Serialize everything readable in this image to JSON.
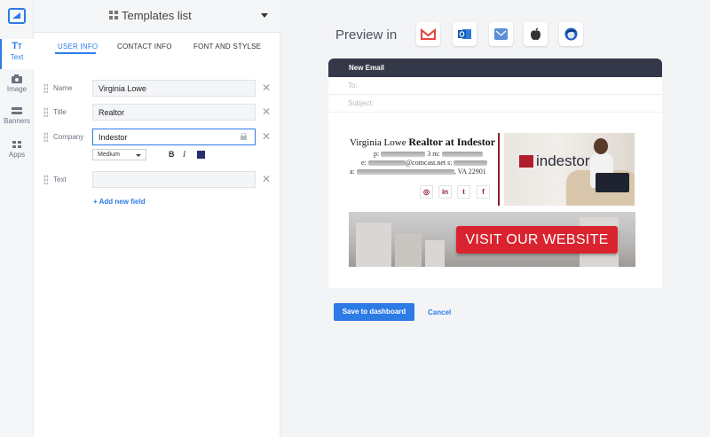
{
  "rail": {
    "items": [
      {
        "label": "Text",
        "icon": "text-icon",
        "active": true
      },
      {
        "label": "Image",
        "icon": "camera-icon"
      },
      {
        "label": "Banners",
        "icon": "banners-icon"
      },
      {
        "label": "Apps",
        "icon": "apps-icon"
      }
    ]
  },
  "panel": {
    "title": "Templates list",
    "tabs": [
      "USER INFO",
      "CONTACT INFO",
      "FONT AND STYLSE"
    ],
    "fields": [
      {
        "label": "Name",
        "value": "Virginia Lowe"
      },
      {
        "label": "Title",
        "value": "Realtor"
      },
      {
        "label": "Company",
        "value": "Indestor"
      },
      {
        "label": "Text",
        "value": ""
      }
    ],
    "format": {
      "size": "Medium",
      "bold": "B",
      "italic": "I",
      "color": "#25306b"
    },
    "add_field": "+ Add new field"
  },
  "preview": {
    "title": "Preview in",
    "clients": [
      "gmail-icon",
      "outlook-icon",
      "apple-mail-icon",
      "apple-icon",
      "thunderbird-icon"
    ],
    "email": {
      "header": "New Email",
      "to_label": "To:",
      "subject_label": "Subject:"
    },
    "signature": {
      "name": "Virginia Lowe",
      "title_company": "Realtor at Indestor",
      "phone_prefix": "p:",
      "phone_mid": "3 m:",
      "email_prefix": "e:",
      "email_domain": "@comcast.net s:",
      "address_prefix": "a:",
      "address_suffix": ", VA 22901",
      "social": [
        "instagram-icon",
        "linkedin-icon",
        "twitter-icon",
        "facebook-icon"
      ],
      "brand": "indestor",
      "accent": "#8b1f2a"
    },
    "banner_cta": "VISIT OUR WEBSITE"
  },
  "actions": {
    "save": "Save to dashboard",
    "cancel": "Cancel"
  }
}
